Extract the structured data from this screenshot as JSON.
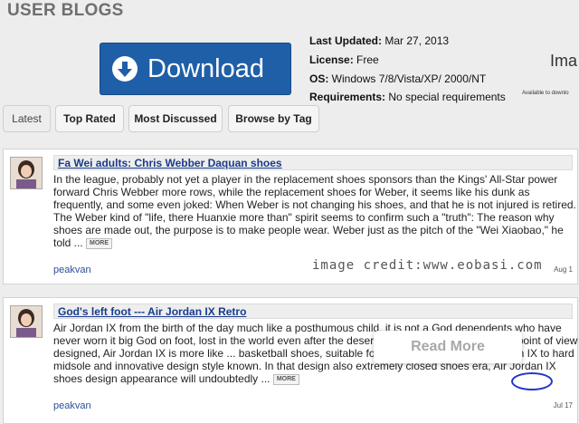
{
  "page": {
    "title": "USER BLOGS"
  },
  "download": {
    "label": "Download",
    "icon": "download-arrow-icon",
    "color": "#1f5fa8"
  },
  "info": {
    "updated_label": "Last Updated:",
    "updated_value": " Mar 27, 2013",
    "license_label": "License:",
    "license_value": " Free",
    "os_label": "OS:",
    "os_value": " Windows 7/8/Vista/XP/ 2000/NT",
    "req_label": "Requirements:",
    "req_value": " No special requirements"
  },
  "ad": {
    "cut_text": "Ima",
    "small_text": "Available to downlo"
  },
  "tabs": [
    {
      "label": "Latest"
    },
    {
      "label": "Top Rated"
    },
    {
      "label": "Most Discussed"
    },
    {
      "label": "Browse by Tag"
    }
  ],
  "posts": [
    {
      "title": "Fa Wei adults: Chris Webber Daquan shoes",
      "body": "In the league, probably not yet a player in the replacement shoes sponsors than the Kings' All-Star power forward Chris Webber more rows, while the replacement shoes for Weber, it seems like his dunk as frequently, and some even joked: When Weber is not changing his shoes, and that he is not injured is retired. The Weber kind of \"life, there Huanxie more than\" spirit seems to confirm such a \"truth\": The reason why shoes are made out, the purpose is to make people wear. Weber just as the pitch of the \"Wei Xiaobao,\" he told ...",
      "more": "MORE",
      "author": "peakvan",
      "date": "Aug 1"
    },
    {
      "title": "God's left foot --- Air Jordan IX Retro",
      "body": "Air Jordan IX from the birth of the day much like a posthumous child, it is not a God dependents who have never worn it big God on foot, lost in the world even after the deserv... jordan sneakers:From the point of view designed, Air Jordan IX is more like ... basketball shoes, suitable for outdoor operations Air Jordan IX to hard midsole and innovative design style known. In that design also extremely closed shoes era, Air Jordan IX shoes design appearance will undoubtedly ...",
      "more": "MORE",
      "author": "peakvan",
      "date": "Jul 17"
    }
  ],
  "overlay": {
    "credit": "image credit:www.eobasi.com",
    "read_more": "Read More"
  }
}
